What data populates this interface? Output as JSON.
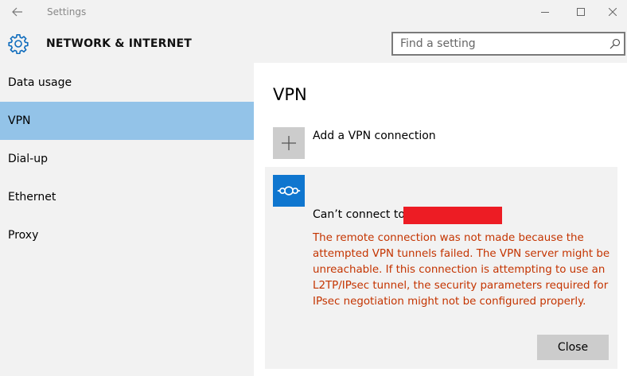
{
  "window": {
    "title": "Settings"
  },
  "header": {
    "section_title": "NETWORK & INTERNET",
    "search_placeholder": "Find a setting"
  },
  "sidebar": {
    "items": [
      {
        "label": "Data usage",
        "active": false
      },
      {
        "label": "VPN",
        "active": true
      },
      {
        "label": "Dial-up",
        "active": false
      },
      {
        "label": "Ethernet",
        "active": false
      },
      {
        "label": "Proxy",
        "active": false
      }
    ]
  },
  "main": {
    "title": "VPN",
    "add_connection_label": "Add a VPN connection",
    "vpn_card": {
      "status": "Can’t connect to",
      "error": "The remote connection was not made because the attempted VPN tunnels failed. The VPN server might be unreachable. If this connection is attempting to use an L2TP/IPsec tunnel, the security parameters required for IPsec negotiation might not be configured properly.",
      "close_label": "Close"
    }
  },
  "colors": {
    "accent": "#0f76cf",
    "active_nav": "#93c3e8",
    "error": "#c43400",
    "redaction": "#ed1c24"
  },
  "icons": {
    "back": "arrow-left-icon",
    "settings": "gear-icon",
    "search": "search-icon",
    "add": "plus-icon",
    "vpn": "vpn-icon"
  }
}
